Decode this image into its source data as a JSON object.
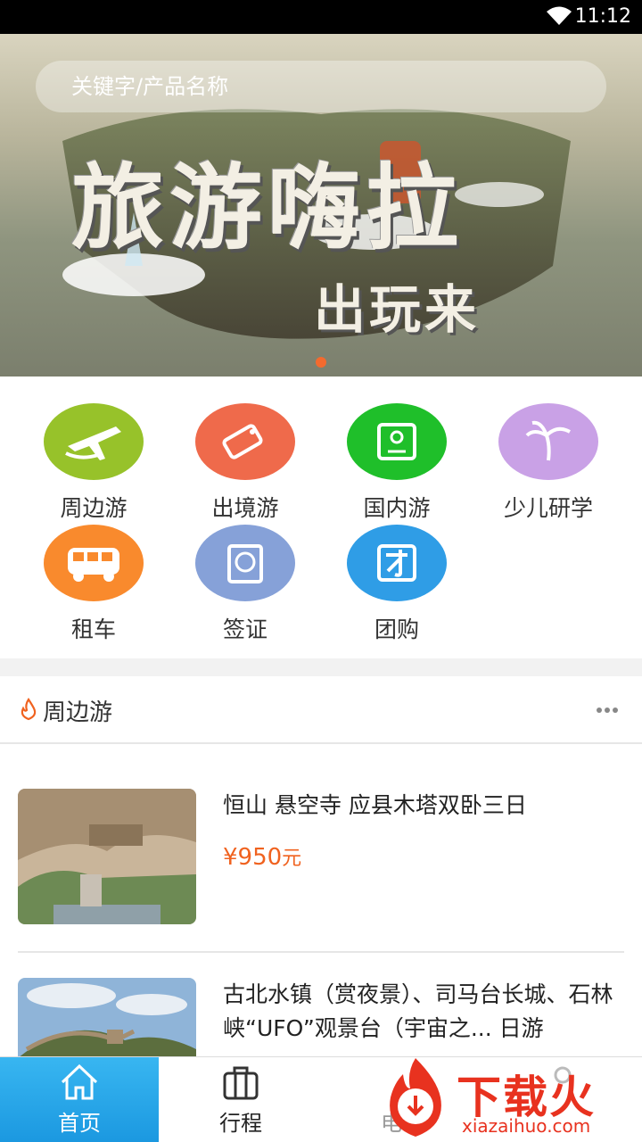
{
  "status": {
    "time": "11:12"
  },
  "search": {
    "placeholder": "关键字/产品名称"
  },
  "banner": {
    "text_main": "旅游嗨拉",
    "text_sub": "出玩来"
  },
  "categories": [
    {
      "label": "周边游",
      "icon": "plane-icon",
      "color": "#97c22a"
    },
    {
      "label": "出境游",
      "icon": "tag-icon",
      "color": "#ef6a4b"
    },
    {
      "label": "国内游",
      "icon": "map-pin-icon",
      "color": "#1fbf2a"
    },
    {
      "label": "少儿研学",
      "icon": "palm-tree-icon",
      "color": "#c9a1e6"
    },
    {
      "label": "租车",
      "icon": "bus-icon",
      "color": "#f98a2d"
    },
    {
      "label": "签证",
      "icon": "passport-icon",
      "color": "#86a1d8"
    },
    {
      "label": "团购",
      "icon": "group-buy-icon",
      "color": "#2f9de6"
    }
  ],
  "section": {
    "title": "周边游",
    "items": [
      {
        "title": "恒山 悬空寺 应县木塔双卧三日",
        "price": "¥950",
        "unit": "元"
      },
      {
        "title": "古北水镇（赏夜景）、司马台长城、石林峡“UFO”观景台（宇宙之... 日游",
        "price": "",
        "unit": ""
      }
    ]
  },
  "tabs": [
    {
      "label": "首页",
      "icon": "home-icon",
      "active": true
    },
    {
      "label": "行程",
      "icon": "briefcase-icon",
      "active": false
    },
    {
      "label": "电话",
      "icon": "phone-icon",
      "active": false
    },
    {
      "label": "",
      "icon": "user-icon",
      "active": false
    }
  ],
  "watermark": {
    "text": "下载火",
    "sub": "xiazaihuo.com"
  }
}
